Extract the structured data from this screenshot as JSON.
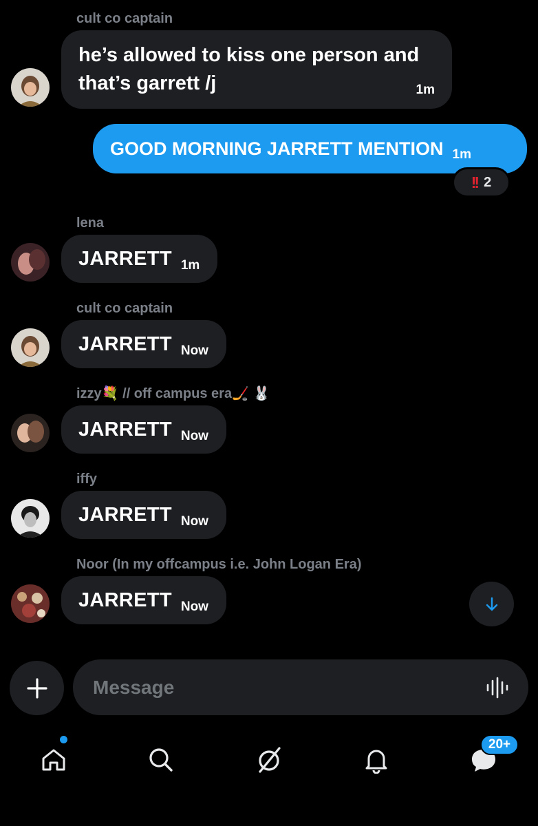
{
  "chat": {
    "messages": [
      {
        "sender": "cult co captain",
        "text_lines": [
          "he’s allowed to kiss one person and",
          "that’s garrett /j"
        ],
        "time": "1m"
      },
      {
        "text": "GOOD MORNING JARRETT MENTION",
        "time": "1m",
        "outgoing": true,
        "reaction": {
          "emoji": "‼️",
          "count": "2"
        }
      },
      {
        "sender": "lena",
        "text": "JARRETT",
        "time": "1m"
      },
      {
        "sender": "cult co captain",
        "text": "JARRETT",
        "time": "Now"
      },
      {
        "sender": "izzy💐 // off campus era🏒 🐰",
        "text": "JARRETT",
        "time": "Now"
      },
      {
        "sender": "iffy",
        "text": "JARRETT",
        "time": "Now"
      },
      {
        "sender": "Noor (In my offcampus i.e. John Logan Era)",
        "text": "JARRETT",
        "time": "Now"
      }
    ]
  },
  "composer": {
    "placeholder": "Message",
    "add_icon": "plus-icon",
    "voice_icon": "voice-waveform-icon"
  },
  "scroll_button": {
    "icon": "arrow-down-icon"
  },
  "bottom_nav": {
    "items": [
      "home-icon",
      "search-icon",
      "grok-icon",
      "notifications-bell-icon",
      "messages-icon"
    ],
    "messages_badge": "20+",
    "home_has_unread_dot": true
  },
  "colors": {
    "background": "#000000",
    "bubble_incoming": "#1d1f23",
    "bubble_outgoing": "#1d9bf0",
    "sender_name": "#7b8088",
    "accent": "#1d9bf0"
  }
}
